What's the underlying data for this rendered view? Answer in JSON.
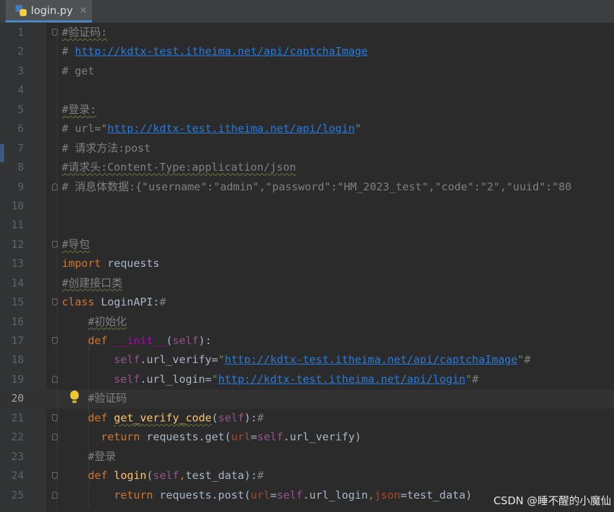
{
  "tab": {
    "title": "login.py",
    "close_icon": "×"
  },
  "current_line": 20,
  "lines": [
    {
      "n": "1",
      "parts": [
        [
          "cm wavy",
          "#验证码:"
        ]
      ]
    },
    {
      "n": "2",
      "parts": [
        [
          "cm",
          "# "
        ],
        [
          "cm lnk",
          "http://kdtx-test.itheima.net/api/captchaImage"
        ]
      ]
    },
    {
      "n": "3",
      "parts": [
        [
          "cm",
          "# get"
        ]
      ]
    },
    {
      "n": "4",
      "parts": []
    },
    {
      "n": "5",
      "parts": [
        [
          "cm wavy",
          "#登录:"
        ]
      ]
    },
    {
      "n": "6",
      "parts": [
        [
          "cm",
          "# url=\""
        ],
        [
          "cm lnk",
          "http://kdtx-test.itheima.net/api/login"
        ],
        [
          "cm",
          "\""
        ]
      ]
    },
    {
      "n": "7",
      "parts": [
        [
          "cm",
          "# 请求方法:post"
        ]
      ]
    },
    {
      "n": "8",
      "parts": [
        [
          "cm wavy",
          "#请求头:Content-Type:application/json"
        ]
      ]
    },
    {
      "n": "9",
      "parts": [
        [
          "cm",
          "# 消息体数据:{\"username\":\"admin\",\"password\":\"HM_2023_test\",\"code\":\"2\",\"uuid\":\"80"
        ]
      ]
    },
    {
      "n": "10",
      "parts": []
    },
    {
      "n": "11",
      "parts": []
    },
    {
      "n": "12",
      "parts": [
        [
          "cm wavy",
          "#导包"
        ]
      ]
    },
    {
      "n": "13",
      "parts": [
        [
          "kw",
          "import"
        ],
        [
          "",
          " requests"
        ]
      ]
    },
    {
      "n": "14",
      "parts": [
        [
          "cm wavy",
          "#创建接口类"
        ]
      ]
    },
    {
      "n": "15",
      "parts": [
        [
          "kw",
          "class"
        ],
        [
          "",
          " LoginAPI:"
        ],
        [
          "cm",
          "#"
        ]
      ]
    },
    {
      "n": "16",
      "parts": [
        [
          "",
          "    "
        ],
        [
          "cm wavy",
          "#初始化"
        ]
      ]
    },
    {
      "n": "17",
      "parts": [
        [
          "",
          "    "
        ],
        [
          "kw",
          "def"
        ],
        [
          "",
          " "
        ],
        [
          "mag",
          "__init__"
        ],
        [
          "",
          "("
        ],
        [
          "slf",
          "self"
        ],
        [
          "",
          "):"
        ]
      ]
    },
    {
      "n": "18",
      "parts": [
        [
          "",
          "        "
        ],
        [
          "slf",
          "self"
        ],
        [
          "",
          ".url_verify="
        ],
        [
          "str",
          "\""
        ],
        [
          "str lnk",
          "http://kdtx-test.itheima.net/api/captchaImage"
        ],
        [
          "str",
          "\""
        ],
        [
          "cm",
          "#"
        ]
      ]
    },
    {
      "n": "19",
      "parts": [
        [
          "",
          "        "
        ],
        [
          "slf",
          "self"
        ],
        [
          "",
          ".url_login="
        ],
        [
          "str",
          "\""
        ],
        [
          "str lnk",
          "http://kdtx-test.itheima.net/api/login"
        ],
        [
          "str",
          "\""
        ],
        [
          "cm",
          "#"
        ]
      ]
    },
    {
      "n": "20",
      "parts": [
        [
          "",
          "    "
        ],
        [
          "cm",
          "#验证码"
        ]
      ]
    },
    {
      "n": "21",
      "parts": [
        [
          "",
          "    "
        ],
        [
          "kw",
          "def"
        ],
        [
          "",
          " "
        ],
        [
          "fn wavy",
          "get_verify_code"
        ],
        [
          "",
          "("
        ],
        [
          "slf",
          "self"
        ],
        [
          "",
          "):"
        ],
        [
          "cm",
          "#"
        ]
      ]
    },
    {
      "n": "22",
      "parts": [
        [
          "",
          "      "
        ],
        [
          "kw",
          "return"
        ],
        [
          "",
          " requests.get("
        ],
        [
          "par",
          "url"
        ],
        [
          "",
          "="
        ],
        [
          "slf",
          "self"
        ],
        [
          "",
          ".url_verify)"
        ]
      ]
    },
    {
      "n": "23",
      "parts": [
        [
          "",
          "    "
        ],
        [
          "cm",
          "#登录"
        ]
      ]
    },
    {
      "n": "24",
      "parts": [
        [
          "",
          "    "
        ],
        [
          "kw",
          "def"
        ],
        [
          "",
          " "
        ],
        [
          "fn",
          "login"
        ],
        [
          "",
          "("
        ],
        [
          "slf",
          "self"
        ],
        [
          "kw",
          ","
        ],
        [
          "",
          "test_data):"
        ],
        [
          "cm",
          "#"
        ]
      ]
    },
    {
      "n": "25",
      "parts": [
        [
          "",
          "        "
        ],
        [
          "kw",
          "return"
        ],
        [
          "",
          " requests.post("
        ],
        [
          "par",
          "url"
        ],
        [
          "",
          "="
        ],
        [
          "slf",
          "self"
        ],
        [
          "",
          ".url_login"
        ],
        [
          "kw",
          ","
        ],
        [
          "par",
          "json"
        ],
        [
          "",
          "=test_data)"
        ]
      ]
    }
  ],
  "watermark": "CSDN @睡不醒的小魔仙"
}
